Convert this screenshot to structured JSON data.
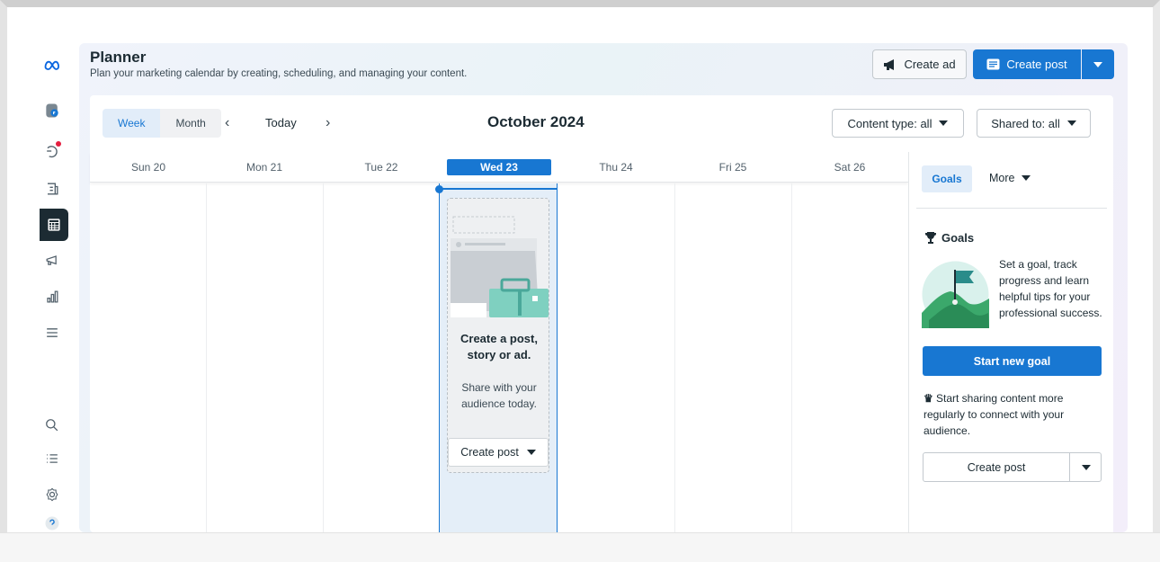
{
  "header": {
    "title": "Planner",
    "subtitle": "Plan your marketing calendar by creating, scheduling, and managing your content.",
    "create_ad_label": "Create ad",
    "create_post_label": "Create post"
  },
  "calendar": {
    "view_options": [
      "Week",
      "Month"
    ],
    "active_view": "Week",
    "today_label": "Today",
    "month_label": "October 2024",
    "filters": {
      "content_type": "Content type: all",
      "shared_to": "Shared to: all"
    },
    "days": [
      "Sun 20",
      "Mon 21",
      "Tue 22",
      "Wed 23",
      "Thu 24",
      "Fri 25",
      "Sat 26"
    ],
    "today_index": 3,
    "empty_state": {
      "title": "Create a post, story or ad.",
      "text": "Share with your audience today.",
      "button_label": "Create post"
    }
  },
  "right_panel": {
    "tabs": [
      "Goals",
      "More"
    ],
    "goals_heading": "Goals",
    "goals_text": "Set a goal, track progress and learn helpful tips for your professional success.",
    "start_goal_label": "Start new goal",
    "share_text": "Start sharing content more regularly to connect with your audience.",
    "create_post_label": "Create post"
  },
  "colors": {
    "accent": "#1877d2",
    "today_column": "#e4eef8",
    "dark_text": "#1c2b33"
  },
  "sidebar_icons": [
    "meta-logo-icon",
    "page-avatar-icon",
    "notifications-icon",
    "content-icon",
    "planner-icon",
    "ads-icon",
    "insights-icon",
    "menu-icon",
    "search-icon",
    "list-icon",
    "settings-icon",
    "help-icon"
  ]
}
